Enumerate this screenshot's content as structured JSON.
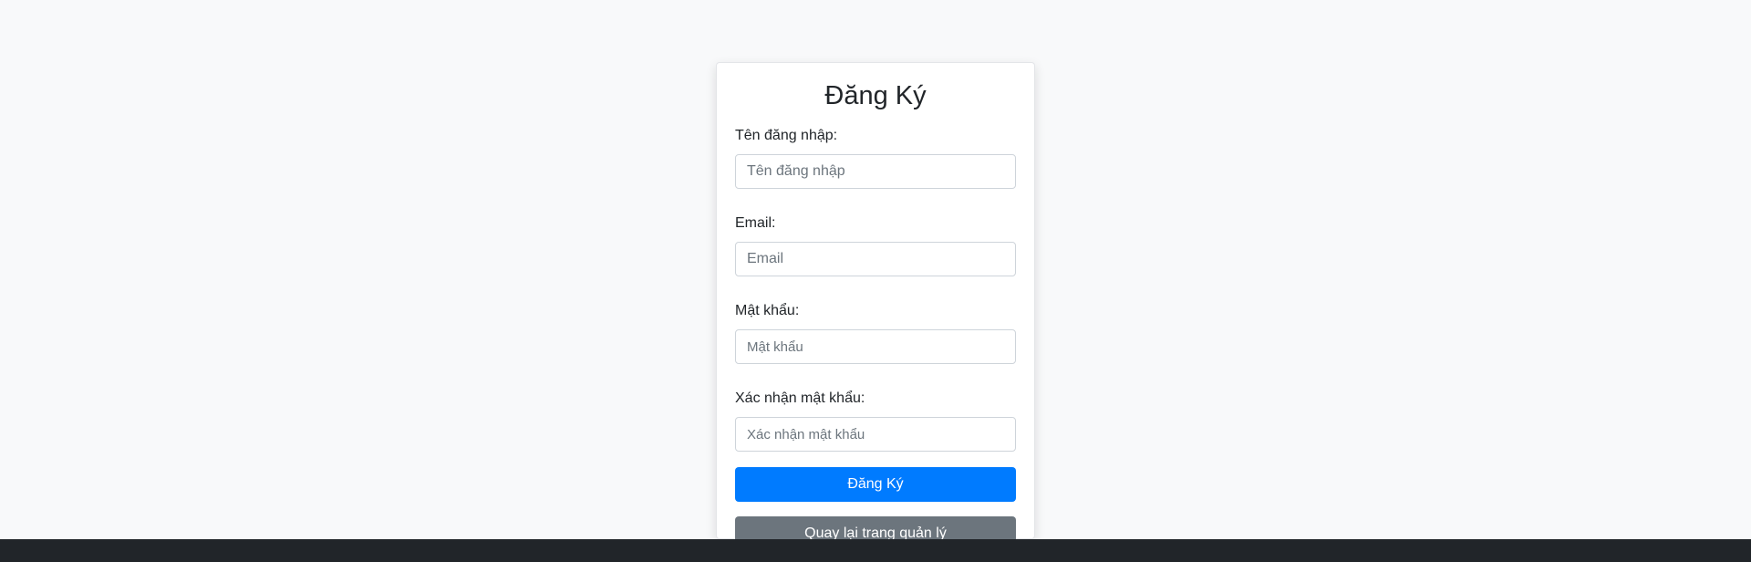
{
  "form": {
    "title": "Đăng Ký",
    "username": {
      "label": "Tên đăng nhập:",
      "placeholder": "Tên đăng nhập"
    },
    "email": {
      "label": "Email:",
      "placeholder": "Email"
    },
    "password": {
      "label": "Mật khẩu:",
      "placeholder": "Mật khẩu"
    },
    "confirm_password": {
      "label": "Xác nhận mật khẩu:",
      "placeholder": "Xác nhận mật khẩu"
    },
    "submit_label": "Đăng Ký",
    "back_label": "Quay lại trang quản lý"
  },
  "colors": {
    "background": "#f8f9fa",
    "primary": "#007bff",
    "secondary": "#6c757d",
    "footer": "#212529"
  }
}
